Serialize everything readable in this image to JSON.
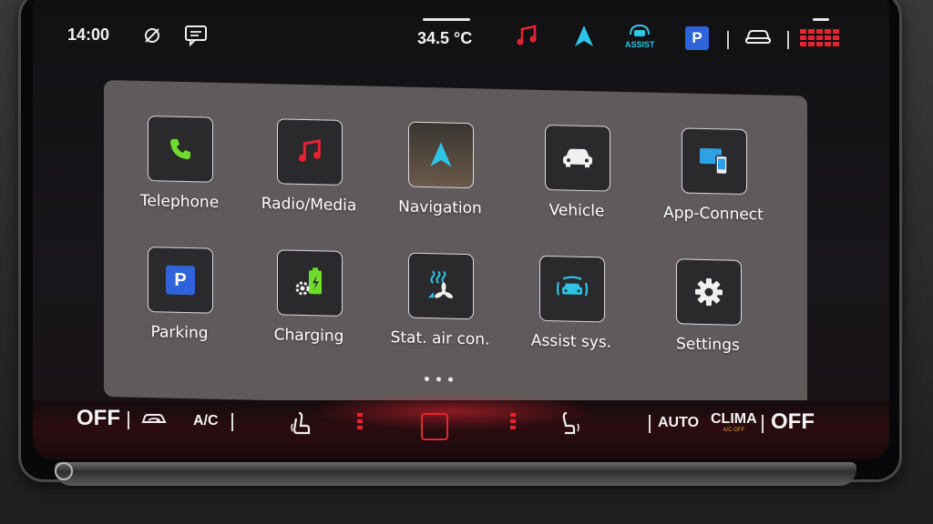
{
  "status_bar": {
    "time": "14:00",
    "outside_temp": "34.5 °C",
    "assist_label": "ASSIST",
    "parking_letter": "P",
    "icons": [
      "no-location-icon",
      "message-icon",
      "music-note-icon",
      "navigation-arrow-icon",
      "assist-icon",
      "parking-icon",
      "car-icon",
      "grid-menu-icon"
    ]
  },
  "apps": {
    "row1": [
      {
        "label": "Telephone",
        "icon": "phone-icon"
      },
      {
        "label": "Radio/Media",
        "icon": "music-note-icon"
      },
      {
        "label": "Navigation",
        "icon": "navigation-arrow-icon"
      },
      {
        "label": "Vehicle",
        "icon": "car-front-icon"
      },
      {
        "label": "App-Connect",
        "icon": "app-connect-icon"
      }
    ],
    "row2": [
      {
        "label": "Parking",
        "icon": "parking-icon"
      },
      {
        "label": "Charging",
        "icon": "charging-icon"
      },
      {
        "label": "Stat. air con.",
        "icon": "air-con-icon"
      },
      {
        "label": "Assist sys.",
        "icon": "assist-icon"
      },
      {
        "label": "Settings",
        "icon": "gear-icon"
      }
    ],
    "parking_letter": "P"
  },
  "page_indicator": {
    "pages": 3,
    "active": 1
  },
  "climate_bar": {
    "left_off": "OFF",
    "ac": "A/C",
    "auto": "AUTO",
    "clima": "CLIMA",
    "clima_sub": "A/C OFF",
    "right_off": "OFF"
  },
  "colors": {
    "accent_red": "#e8232f",
    "accent_cyan": "#2ec4e6",
    "phone_green": "#6fdc2c",
    "parking_blue": "#2f63d9"
  }
}
